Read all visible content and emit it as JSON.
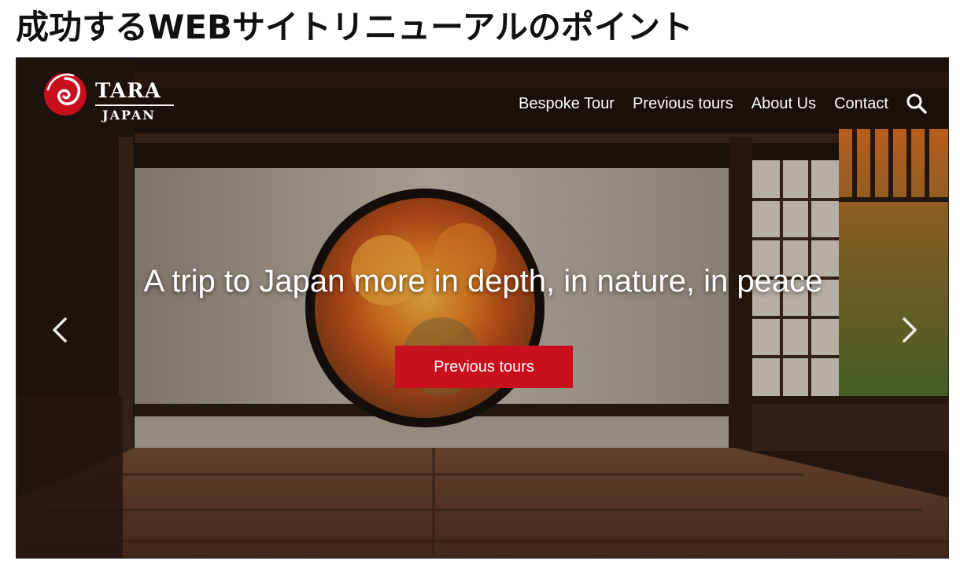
{
  "page": {
    "heading": "成功するWEBサイトリニューアルのポイント"
  },
  "site": {
    "logo": {
      "line1": "TARA",
      "line2": "JAPAN",
      "mark_icon": "swirl-logo-icon",
      "brand_color": "#c80f1d"
    },
    "nav": [
      {
        "label": "Bespoke Tour"
      },
      {
        "label": "Previous tours"
      },
      {
        "label": "About Us"
      },
      {
        "label": "Contact"
      }
    ],
    "search_icon": "search-icon",
    "hero": {
      "title": "A trip to Japan more in depth, in nature, in peace",
      "cta_label": "Previous tours",
      "cta_color": "#c80f1d",
      "prev_icon": "chevron-left-icon",
      "next_icon": "chevron-right-icon"
    }
  }
}
